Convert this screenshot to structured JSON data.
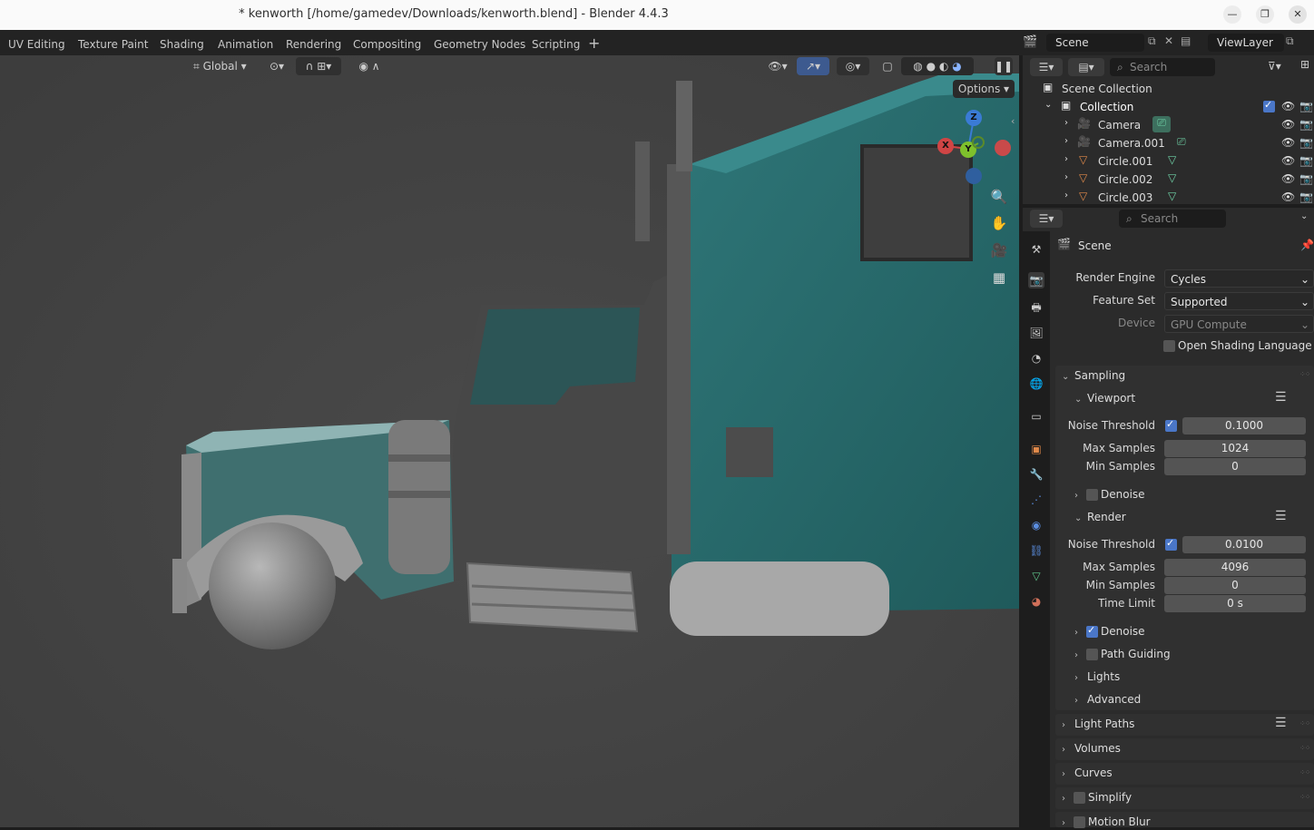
{
  "window": {
    "title": "* kenworth [/home/gamedev/Downloads/kenworth.blend] - Blender 4.4.3"
  },
  "workspace_tabs": [
    "UV Editing",
    "Texture Paint",
    "Shading",
    "Animation",
    "Rendering",
    "Compositing",
    "Geometry Nodes",
    "Scripting"
  ],
  "scene_field": "Scene",
  "view_layer_field": "ViewLayer",
  "viewport_header": {
    "orientation": "Global",
    "options_label": "Options"
  },
  "outliner": {
    "search_placeholder": "Search",
    "scene_collection": "Scene Collection",
    "collection": "Collection",
    "items": [
      "Camera",
      "Camera.001",
      "Circle.001",
      "Circle.002",
      "Circle.003"
    ]
  },
  "properties": {
    "search_placeholder": "Search",
    "context": "Scene",
    "render_engine_label": "Render Engine",
    "render_engine": "Cycles",
    "feature_set_label": "Feature Set",
    "feature_set": "Supported",
    "device_label": "Device",
    "device": "GPU Compute",
    "osl_label": "Open Shading Language",
    "sampling": "Sampling",
    "viewport": "Viewport",
    "vp_noise_label": "Noise Threshold",
    "vp_noise": "0.1000",
    "vp_max_label": "Max Samples",
    "vp_max": "1024",
    "vp_min_label": "Min Samples",
    "vp_min": "0",
    "vp_denoise": "Denoise",
    "render": "Render",
    "r_noise_label": "Noise Threshold",
    "r_noise": "0.0100",
    "r_max_label": "Max Samples",
    "r_max": "4096",
    "r_min_label": "Min Samples",
    "r_min": "0",
    "r_time_label": "Time Limit",
    "r_time": "0 s",
    "r_denoise": "Denoise",
    "path_guiding": "Path Guiding",
    "lights": "Lights",
    "advanced": "Advanced",
    "light_paths": "Light Paths",
    "volumes": "Volumes",
    "curves": "Curves",
    "simplify": "Simplify",
    "motion_blur": "Motion Blur"
  },
  "gizmo": {
    "x": "X",
    "y": "Y",
    "z": "Z"
  },
  "colors": {
    "accent": "#4a76c7",
    "truck": "#2b6f70",
    "viewport_bg": "#444444"
  }
}
